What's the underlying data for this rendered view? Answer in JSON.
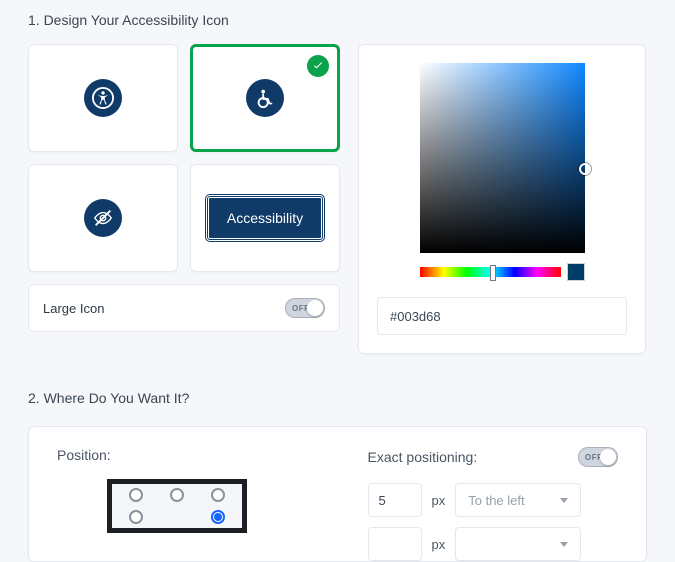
{
  "section1": {
    "title": "1. Design Your Accessibility Icon",
    "tiles": {
      "person": "accessibility-person-icon",
      "wheelchair": "wheelchair-icon",
      "eye": "eye-slash-icon",
      "label": "Accessibility"
    },
    "largeIcon": {
      "label": "Large Icon",
      "toggle": "OFF"
    },
    "color": {
      "hex": "#003d68"
    }
  },
  "section2": {
    "title": "2. Where Do You Want It?",
    "position": {
      "label": "Position:"
    },
    "exact": {
      "label": "Exact positioning:",
      "toggle": "OFF",
      "value1": "5",
      "unit": "px",
      "dir1": "To the left"
    }
  }
}
